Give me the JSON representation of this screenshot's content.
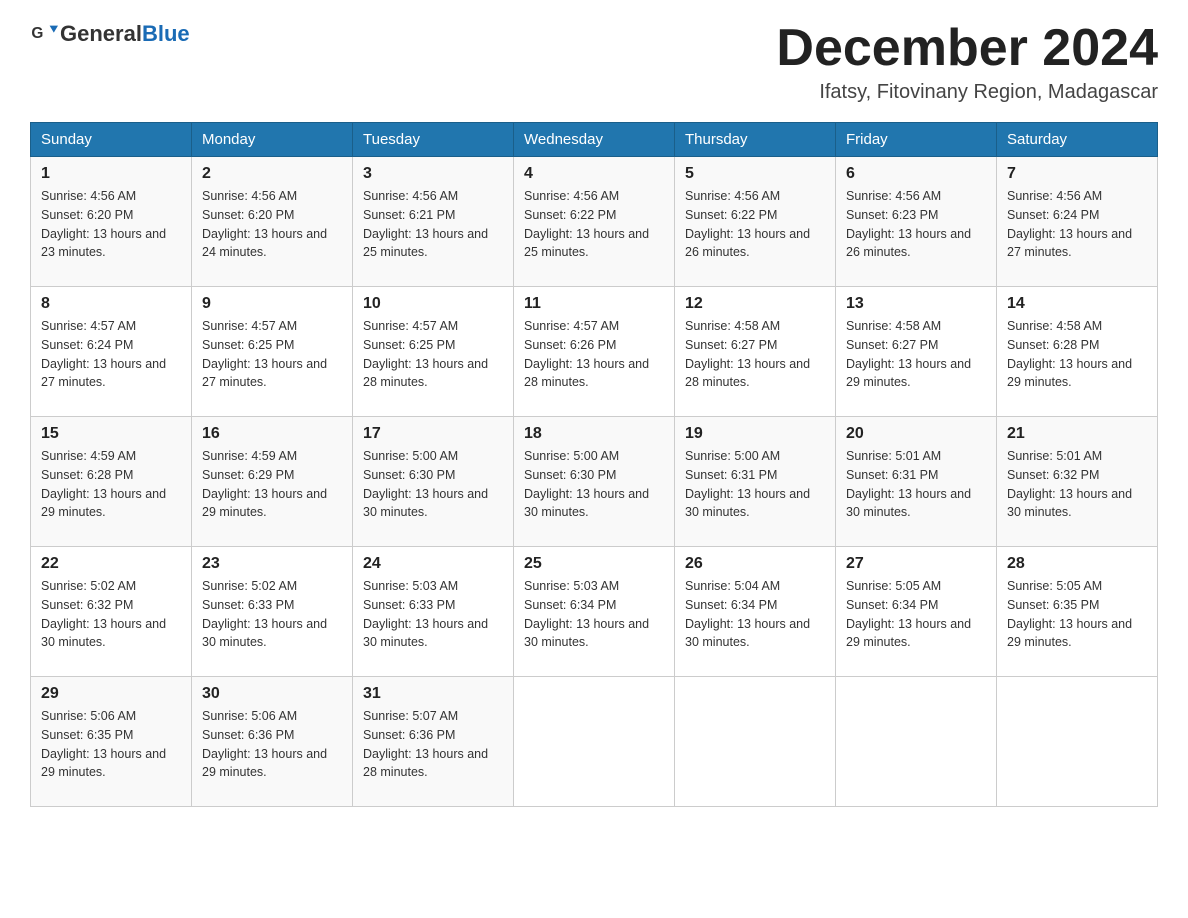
{
  "header": {
    "logo_text_general": "General",
    "logo_text_blue": "Blue",
    "month_title": "December 2024",
    "location": "Ifatsy, Fitovinany Region, Madagascar"
  },
  "days_of_week": [
    "Sunday",
    "Monday",
    "Tuesday",
    "Wednesday",
    "Thursday",
    "Friday",
    "Saturday"
  ],
  "weeks": [
    [
      {
        "day": "1",
        "sunrise": "4:56 AM",
        "sunset": "6:20 PM",
        "daylight": "13 hours and 23 minutes."
      },
      {
        "day": "2",
        "sunrise": "4:56 AM",
        "sunset": "6:20 PM",
        "daylight": "13 hours and 24 minutes."
      },
      {
        "day": "3",
        "sunrise": "4:56 AM",
        "sunset": "6:21 PM",
        "daylight": "13 hours and 25 minutes."
      },
      {
        "day": "4",
        "sunrise": "4:56 AM",
        "sunset": "6:22 PM",
        "daylight": "13 hours and 25 minutes."
      },
      {
        "day": "5",
        "sunrise": "4:56 AM",
        "sunset": "6:22 PM",
        "daylight": "13 hours and 26 minutes."
      },
      {
        "day": "6",
        "sunrise": "4:56 AM",
        "sunset": "6:23 PM",
        "daylight": "13 hours and 26 minutes."
      },
      {
        "day": "7",
        "sunrise": "4:56 AM",
        "sunset": "6:24 PM",
        "daylight": "13 hours and 27 minutes."
      }
    ],
    [
      {
        "day": "8",
        "sunrise": "4:57 AM",
        "sunset": "6:24 PM",
        "daylight": "13 hours and 27 minutes."
      },
      {
        "day": "9",
        "sunrise": "4:57 AM",
        "sunset": "6:25 PM",
        "daylight": "13 hours and 27 minutes."
      },
      {
        "day": "10",
        "sunrise": "4:57 AM",
        "sunset": "6:25 PM",
        "daylight": "13 hours and 28 minutes."
      },
      {
        "day": "11",
        "sunrise": "4:57 AM",
        "sunset": "6:26 PM",
        "daylight": "13 hours and 28 minutes."
      },
      {
        "day": "12",
        "sunrise": "4:58 AM",
        "sunset": "6:27 PM",
        "daylight": "13 hours and 28 minutes."
      },
      {
        "day": "13",
        "sunrise": "4:58 AM",
        "sunset": "6:27 PM",
        "daylight": "13 hours and 29 minutes."
      },
      {
        "day": "14",
        "sunrise": "4:58 AM",
        "sunset": "6:28 PM",
        "daylight": "13 hours and 29 minutes."
      }
    ],
    [
      {
        "day": "15",
        "sunrise": "4:59 AM",
        "sunset": "6:28 PM",
        "daylight": "13 hours and 29 minutes."
      },
      {
        "day": "16",
        "sunrise": "4:59 AM",
        "sunset": "6:29 PM",
        "daylight": "13 hours and 29 minutes."
      },
      {
        "day": "17",
        "sunrise": "5:00 AM",
        "sunset": "6:30 PM",
        "daylight": "13 hours and 30 minutes."
      },
      {
        "day": "18",
        "sunrise": "5:00 AM",
        "sunset": "6:30 PM",
        "daylight": "13 hours and 30 minutes."
      },
      {
        "day": "19",
        "sunrise": "5:00 AM",
        "sunset": "6:31 PM",
        "daylight": "13 hours and 30 minutes."
      },
      {
        "day": "20",
        "sunrise": "5:01 AM",
        "sunset": "6:31 PM",
        "daylight": "13 hours and 30 minutes."
      },
      {
        "day": "21",
        "sunrise": "5:01 AM",
        "sunset": "6:32 PM",
        "daylight": "13 hours and 30 minutes."
      }
    ],
    [
      {
        "day": "22",
        "sunrise": "5:02 AM",
        "sunset": "6:32 PM",
        "daylight": "13 hours and 30 minutes."
      },
      {
        "day": "23",
        "sunrise": "5:02 AM",
        "sunset": "6:33 PM",
        "daylight": "13 hours and 30 minutes."
      },
      {
        "day": "24",
        "sunrise": "5:03 AM",
        "sunset": "6:33 PM",
        "daylight": "13 hours and 30 minutes."
      },
      {
        "day": "25",
        "sunrise": "5:03 AM",
        "sunset": "6:34 PM",
        "daylight": "13 hours and 30 minutes."
      },
      {
        "day": "26",
        "sunrise": "5:04 AM",
        "sunset": "6:34 PM",
        "daylight": "13 hours and 30 minutes."
      },
      {
        "day": "27",
        "sunrise": "5:05 AM",
        "sunset": "6:34 PM",
        "daylight": "13 hours and 29 minutes."
      },
      {
        "day": "28",
        "sunrise": "5:05 AM",
        "sunset": "6:35 PM",
        "daylight": "13 hours and 29 minutes."
      }
    ],
    [
      {
        "day": "29",
        "sunrise": "5:06 AM",
        "sunset": "6:35 PM",
        "daylight": "13 hours and 29 minutes."
      },
      {
        "day": "30",
        "sunrise": "5:06 AM",
        "sunset": "6:36 PM",
        "daylight": "13 hours and 29 minutes."
      },
      {
        "day": "31",
        "sunrise": "5:07 AM",
        "sunset": "6:36 PM",
        "daylight": "13 hours and 28 minutes."
      },
      null,
      null,
      null,
      null
    ]
  ]
}
